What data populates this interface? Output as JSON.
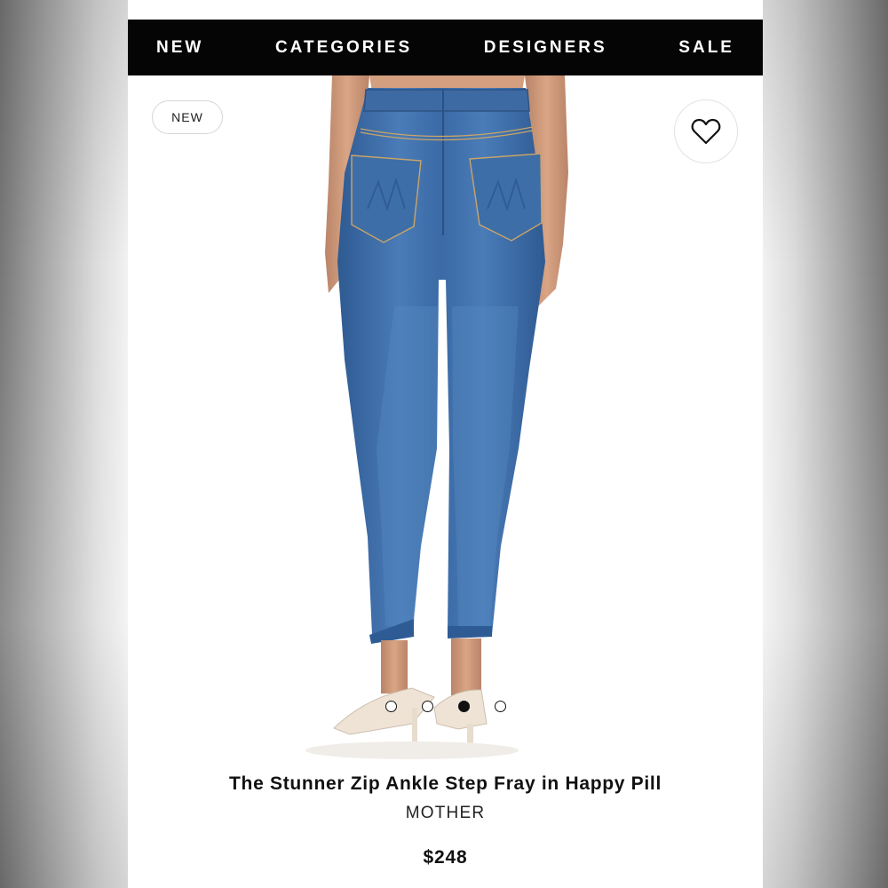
{
  "nav": {
    "items": [
      {
        "label": "NEW"
      },
      {
        "label": "CATEGORIES"
      },
      {
        "label": "DESIGNERS"
      },
      {
        "label": "SALE"
      }
    ]
  },
  "product": {
    "badge": "NEW",
    "wishlist_icon": "heart-outline-icon",
    "carousel": {
      "count": 4,
      "active_index": 2
    },
    "title": "The Stunner Zip Ankle Step Fray in Happy Pill",
    "brand": "MOTHER",
    "price": "$248"
  },
  "colors": {
    "nav_bg": "#050505",
    "nav_text": "#ffffff",
    "denim": "#3f6ea8"
  }
}
